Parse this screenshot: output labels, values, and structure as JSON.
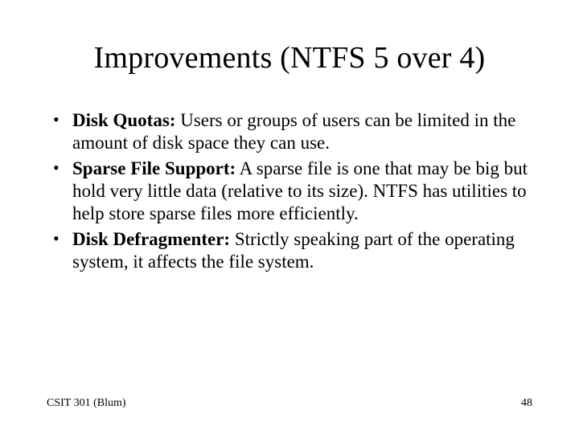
{
  "title": "Improvements (NTFS 5 over 4)",
  "bullets": [
    {
      "term": "Disk Quotas:",
      "text": " Users or groups of users can be limited in the amount of disk space they can use."
    },
    {
      "term": "Sparse File Support:",
      "text": " A sparse file is one that may be big but hold very little data (relative to its size). NTFS has utilities to help store sparse files more efficiently."
    },
    {
      "term": "Disk Defragmenter:",
      "text": " Strictly speaking part of the operating system, it affects the file system."
    }
  ],
  "footer": {
    "left": "CSIT 301 (Blum)",
    "right": "48"
  }
}
